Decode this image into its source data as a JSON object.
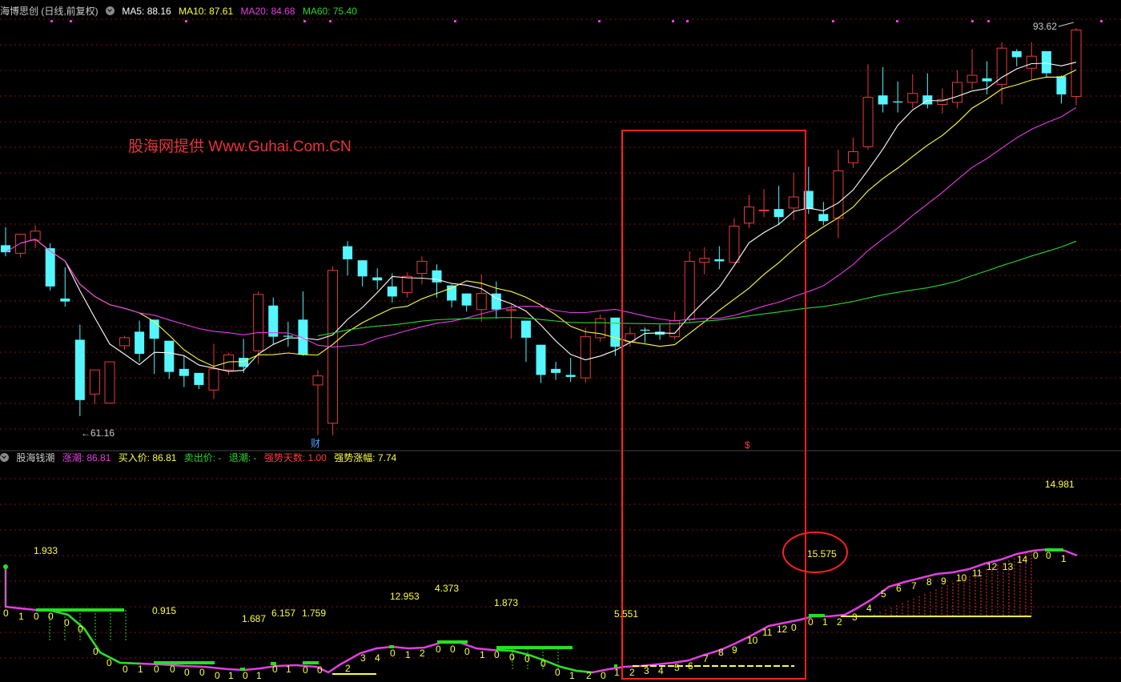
{
  "top_panel": {
    "title": "海博思创 (日线,前复权)",
    "ma5": "MA5: 88.16",
    "ma10": "MA10: 87.61",
    "ma20": "MA20: 84.68",
    "ma60": "MA60: 75.40",
    "high_label": "93.62",
    "low_label": "61.16",
    "marker_cai": "财",
    "marker_s": "$",
    "watermark": "股海网提供 Www.Guhai.Com.CN"
  },
  "bottom_panel": {
    "title": "股海钱潮",
    "zhangchao": "涨潮: 86.81",
    "buy_price": "买入价: 86.81",
    "sell_price": "卖出价: -",
    "tuichao": "退潮: -",
    "strong_days": "强势天数: 1.00",
    "strong_gain": "强势涨幅: 7.74",
    "value_labels": [
      "1.933",
      "0.915",
      "1.687",
      "6.157",
      "1.759",
      "12.953",
      "4.373",
      "1.873",
      "5.551",
      "15.575",
      "14.981"
    ],
    "counter_labels": [
      "0",
      "1",
      "0",
      "0",
      "0",
      "0",
      "0",
      "0",
      "0",
      "1",
      "0",
      "0",
      "0",
      "0",
      "0",
      "1",
      "0",
      "1",
      "0",
      "1",
      "0",
      "0",
      "2",
      "3",
      "4",
      "0",
      "1",
      "2",
      "0",
      "0",
      "0",
      "1",
      "0",
      "0",
      "0",
      "0",
      "0",
      "1",
      "2",
      "0",
      "1",
      "2",
      "3",
      "4",
      "5",
      "6",
      "7",
      "8",
      "9",
      "10",
      "11",
      "12",
      "0",
      "0",
      "1",
      "2",
      "3",
      "4",
      "5",
      "6",
      "7",
      "8",
      "9",
      "10",
      "11",
      "12",
      "13",
      "14",
      "0",
      "0",
      "1"
    ]
  },
  "colors": {
    "up": "#e63b3b",
    "down": "#54f6ff",
    "ma5": "#ffffff",
    "ma10": "#ffff3c",
    "ma20": "#e43ee4",
    "ma60": "#2bd62b",
    "highlight": "#ff2020"
  },
  "chart_data": {
    "type": "candlestick",
    "candles": [
      {
        "o": 72.0,
        "h": 73.8,
        "c": 71.3,
        "l": 70.9
      },
      {
        "o": 71.2,
        "h": 72.8,
        "c": 73.1,
        "l": 70.8
      },
      {
        "o": 72.5,
        "h": 74.0,
        "c": 73.4,
        "l": 71.7
      },
      {
        "o": 71.7,
        "h": 72.2,
        "c": 67.9,
        "l": 67.5
      },
      {
        "o": 66.7,
        "h": 69.8,
        "c": 66.4,
        "l": 65.9
      },
      {
        "o": 62.6,
        "h": 64.1,
        "c": 56.6,
        "l": 55.0
      },
      {
        "o": 57.2,
        "h": 58.9,
        "c": 59.6,
        "l": 56.2
      },
      {
        "o": 56.3,
        "h": 59.1,
        "c": 60.4,
        "l": 56.3
      },
      {
        "o": 62.0,
        "h": 63.0,
        "c": 62.8,
        "l": 61.6
      },
      {
        "o": 63.4,
        "h": 64.5,
        "c": 61.2,
        "l": 60.4
      },
      {
        "o": 64.6,
        "h": 63.1,
        "c": 62.7,
        "l": 59.2
      },
      {
        "o": 62.5,
        "h": 61.8,
        "c": 59.4,
        "l": 58.7
      },
      {
        "o": 59.7,
        "h": 61.0,
        "c": 59.0,
        "l": 57.9
      },
      {
        "o": 59.3,
        "h": 59.1,
        "c": 58.1,
        "l": 57.7
      },
      {
        "o": 57.6,
        "h": 62.2,
        "c": 59.7,
        "l": 56.7
      },
      {
        "o": 59.6,
        "h": 61.3,
        "c": 61.1,
        "l": 59.1
      },
      {
        "o": 60.8,
        "h": 62.7,
        "c": 59.9,
        "l": 59.3
      },
      {
        "o": 61.5,
        "h": 67.4,
        "c": 67.1,
        "l": 60.2
      },
      {
        "o": 66.0,
        "h": 66.8,
        "c": 62.9,
        "l": 62.1
      },
      {
        "o": 63.0,
        "h": 64.4,
        "c": 62.9,
        "l": 61.9
      },
      {
        "o": 64.6,
        "h": 67.4,
        "c": 61.1,
        "l": 61.0
      },
      {
        "o": 58.1,
        "h": 59.6,
        "c": 59.0,
        "l": 53.1
      },
      {
        "o": 54.3,
        "h": 69.9,
        "c": 69.5,
        "l": 53.1
      },
      {
        "o": 71.9,
        "h": 72.4,
        "c": 70.6,
        "l": 69.0
      },
      {
        "o": 70.5,
        "h": 70.0,
        "c": 68.9,
        "l": 67.9
      },
      {
        "o": 68.8,
        "h": 69.7,
        "c": 68.5,
        "l": 67.6
      },
      {
        "o": 67.9,
        "h": 69.2,
        "c": 66.9,
        "l": 66.3
      },
      {
        "o": 67.3,
        "h": 69.3,
        "c": 68.9,
        "l": 66.8
      },
      {
        "o": 69.2,
        "h": 70.9,
        "c": 70.4,
        "l": 68.1
      },
      {
        "o": 69.5,
        "h": 70.1,
        "c": 68.3,
        "l": 66.8
      },
      {
        "o": 68.0,
        "h": 68.1,
        "c": 66.5,
        "l": 65.8
      },
      {
        "o": 67.2,
        "h": 66.8,
        "c": 66.0,
        "l": 65.4
      },
      {
        "o": 65.6,
        "h": 69.1,
        "c": 67.2,
        "l": 64.4
      },
      {
        "o": 67.2,
        "h": 68.4,
        "c": 65.6,
        "l": 64.7
      },
      {
        "o": 65.5,
        "h": 66.1,
        "c": 65.6,
        "l": 62.7
      },
      {
        "o": 64.5,
        "h": 64.2,
        "c": 62.8,
        "l": 60.4
      },
      {
        "o": 62.1,
        "h": 60.5,
        "c": 59.1,
        "l": 58.3
      },
      {
        "o": 59.7,
        "h": 60.4,
        "c": 59.3,
        "l": 58.6
      },
      {
        "o": 59.1,
        "h": 60.8,
        "c": 58.9,
        "l": 58.4
      },
      {
        "o": 58.8,
        "h": 63.8,
        "c": 62.9,
        "l": 58.3
      },
      {
        "o": 62.8,
        "h": 65.1,
        "c": 64.7,
        "l": 62.4
      },
      {
        "o": 64.8,
        "h": 63.9,
        "c": 61.9,
        "l": 61.0
      },
      {
        "o": 62.4,
        "h": 63.8,
        "c": 63.2,
        "l": 61.9
      },
      {
        "o": 63.6,
        "h": 63.8,
        "c": 63.5,
        "l": 62.3
      },
      {
        "o": 63.4,
        "h": 64.1,
        "c": 63.1,
        "l": 62.6
      },
      {
        "o": 62.9,
        "h": 65.4,
        "c": 64.5,
        "l": 62.6
      },
      {
        "o": 64.6,
        "h": 71.4,
        "c": 70.4,
        "l": 64.4
      },
      {
        "o": 70.3,
        "h": 71.8,
        "c": 70.7,
        "l": 69.1
      },
      {
        "o": 70.6,
        "h": 71.9,
        "c": 70.4,
        "l": 69.6
      },
      {
        "o": 70.3,
        "h": 74.7,
        "c": 73.9,
        "l": 70.2
      },
      {
        "o": 74.2,
        "h": 77.0,
        "c": 75.8,
        "l": 73.7
      },
      {
        "o": 75.5,
        "h": 77.6,
        "c": 75.5,
        "l": 74.8
      },
      {
        "o": 75.6,
        "h": 77.9,
        "c": 74.8,
        "l": 74.0
      },
      {
        "o": 75.7,
        "h": 79.2,
        "c": 76.8,
        "l": 74.5
      },
      {
        "o": 77.4,
        "h": 79.8,
        "c": 75.6,
        "l": 75.1
      },
      {
        "o": 75.1,
        "h": 76.3,
        "c": 74.4,
        "l": 74.0
      },
      {
        "o": 74.7,
        "h": 81.5,
        "c": 79.4,
        "l": 72.7
      },
      {
        "o": 80.2,
        "h": 82.7,
        "c": 81.3,
        "l": 79.7
      },
      {
        "o": 81.8,
        "h": 90.0,
        "c": 86.7,
        "l": 81.5
      },
      {
        "o": 86.9,
        "h": 89.7,
        "c": 86.0,
        "l": 85.2
      },
      {
        "o": 86.3,
        "h": 88.3,
        "c": 86.2,
        "l": 85.2
      },
      {
        "o": 86.2,
        "h": 89.0,
        "c": 87.1,
        "l": 85.6
      },
      {
        "o": 86.9,
        "h": 89.1,
        "c": 86.0,
        "l": 85.6
      },
      {
        "o": 86.0,
        "h": 87.6,
        "c": 86.5,
        "l": 85.1
      },
      {
        "o": 86.2,
        "h": 89.4,
        "c": 88.2,
        "l": 85.6
      },
      {
        "o": 88.2,
        "h": 91.5,
        "c": 88.9,
        "l": 87.5
      },
      {
        "o": 88.6,
        "h": 90.3,
        "c": 88.3,
        "l": 87.0
      },
      {
        "o": 88.0,
        "h": 92.2,
        "c": 91.6,
        "l": 86.0
      },
      {
        "o": 91.3,
        "h": 91.5,
        "c": 90.7,
        "l": 89.8
      },
      {
        "o": 89.6,
        "h": 92.2,
        "c": 90.8,
        "l": 88.5
      },
      {
        "o": 91.3,
        "h": 90.2,
        "c": 89.1,
        "l": 88.7
      },
      {
        "o": 88.8,
        "h": 88.9,
        "c": 87.0,
        "l": 86.1
      },
      {
        "o": 86.8,
        "h": 93.6,
        "c": 93.4,
        "l": 85.9
      }
    ]
  }
}
